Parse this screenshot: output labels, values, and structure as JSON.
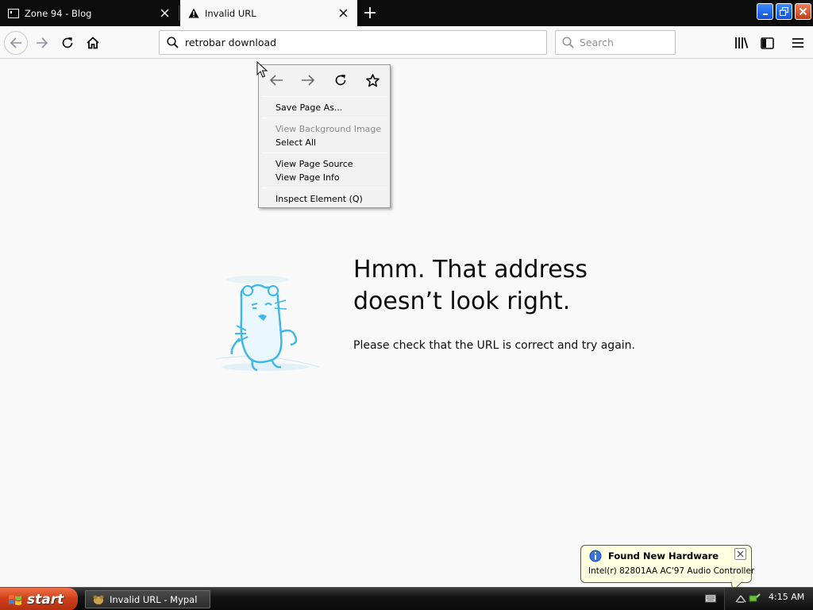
{
  "tabs": [
    {
      "title": "Zone 94 - Blog",
      "favicon": "terminal-icon",
      "active": false
    },
    {
      "title": "Invalid URL",
      "favicon": "warning-icon",
      "active": true
    }
  ],
  "toolbar": {
    "url": "retrobar download",
    "search_placeholder": "Search"
  },
  "context_menu": {
    "nav_icons": [
      "back-icon",
      "forward-icon",
      "reload-icon",
      "bookmark-star-icon"
    ],
    "items": [
      {
        "label": "Save Page As...",
        "enabled": true
      },
      {
        "label": "View Background Image",
        "enabled": false
      },
      {
        "label": "Select All",
        "enabled": true
      },
      {
        "label": "View Page Source",
        "enabled": true
      },
      {
        "label": "View Page Info",
        "enabled": true
      },
      {
        "label": "Inspect Element (Q)",
        "enabled": true
      }
    ]
  },
  "error_page": {
    "title_line1": "Hmm. That address",
    "title_line2": "doesn’t look right.",
    "description": "Please check that the URL is correct and try again."
  },
  "notification": {
    "title": "Found New Hardware",
    "text": "Intel(r) 82801AA AC'97 Audio Controller"
  },
  "taskbar": {
    "start_label": "start",
    "task_label": "Invalid URL - Mypal",
    "clock": "4:15 AM"
  },
  "colors": {
    "tabstrip": "#0c0c0d",
    "page_bg": "#f9f9fa",
    "illustration_blue": "#3fb7e8",
    "balloon_bg": "#ffffe1",
    "start_orange": "#d1401b"
  }
}
